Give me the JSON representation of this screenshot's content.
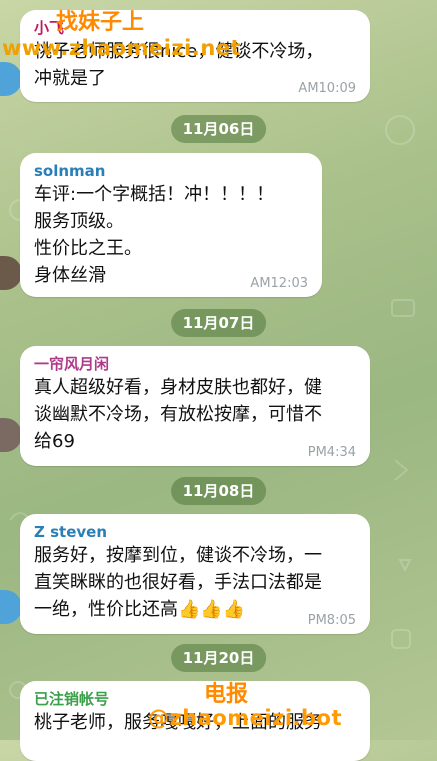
{
  "watermarks": {
    "top_title": "找妹子上",
    "top_url": "www.zhaomeizi.net",
    "bottom_title": "电报",
    "bottom_url": "@zhaomeizi.bot"
  },
  "colors": {
    "sender_1": "#c2185b",
    "sender_2": "#2b7fb8",
    "sender_3": "#b03a8a",
    "sender_4": "#2b7fb8",
    "sender_5": "#3aa04a",
    "date_pill": "#6f9a5b"
  },
  "messages": [
    {
      "sender": "小飞",
      "text": "桃子老师服务很nice，健谈不冷场，\n冲就是了",
      "time": "AM10:09"
    },
    {
      "date": "11月06日",
      "sender": "solnman",
      "text": "车评:一个字概括！冲！！！！\n服务顶级。\n性价比之王。\n身体丝滑",
      "time": "AM12:03"
    },
    {
      "date": "11月07日",
      "sender": "一帘风月闲",
      "text": "真人超级好看，身材皮肤也都好，健\n谈幽默不冷场，有放松按摩，可惜不\n给69",
      "time": "PM4:34"
    },
    {
      "date": "11月08日",
      "sender": "Z steven",
      "text": "服务好，按摩到位，健谈不冷场，一\n直笑眯眯的也很好看，手法口法都是\n一绝，性价比还高👍👍👍",
      "time": "PM8:05"
    },
    {
      "date": "11月20日",
      "sender": "已注销帐号",
      "text": "桃子老师，服务嘎嘎好，上面的服务"
    }
  ]
}
